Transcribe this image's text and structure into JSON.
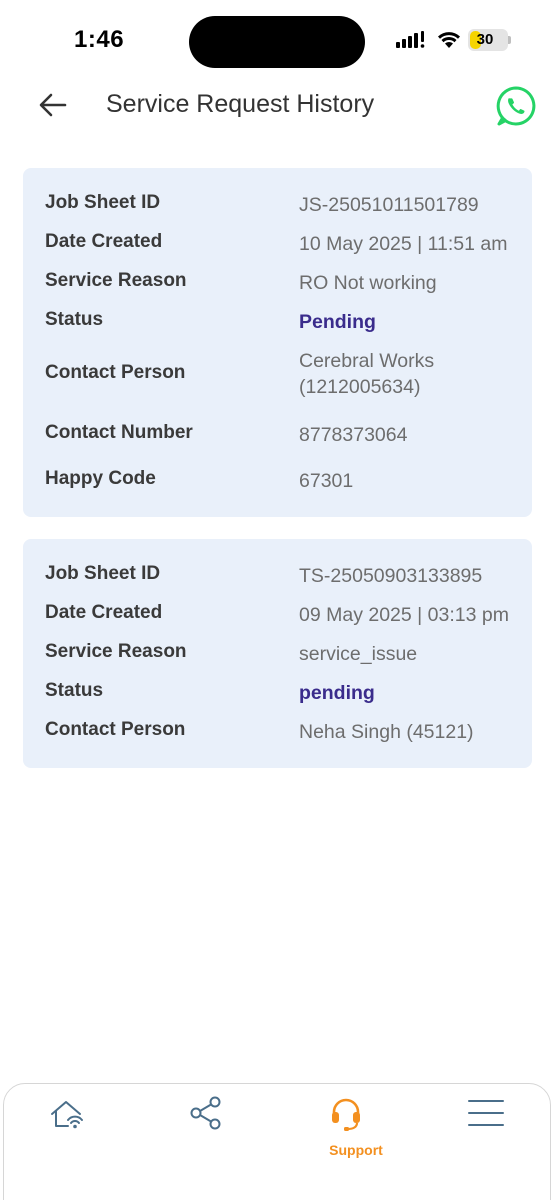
{
  "status_bar": {
    "time": "1:46",
    "battery": "30",
    "battery_level": 0.3
  },
  "header": {
    "title": "Service Request History"
  },
  "colors": {
    "accent": "#f39020",
    "status_text": "#3a2c8c",
    "card_bg": "#e9f0fa",
    "whatsapp": "#25d366",
    "nav_icon": "#4a6e8a"
  },
  "requests": [
    {
      "rows": [
        {
          "label": "Job Sheet ID",
          "value": "JS-25051011501789"
        },
        {
          "label": "Date Created",
          "value": "10 May 2025 | 11:51 am"
        },
        {
          "label": "Service Reason",
          "value": "RO Not working"
        },
        {
          "label": "Status",
          "value": "Pending"
        },
        {
          "label": "Contact Person",
          "value": "Cerebral Works (1212005634)"
        },
        {
          "label": "Contact Number",
          "value": "8778373064"
        },
        {
          "label": "Happy Code",
          "value": "67301"
        }
      ]
    },
    {
      "rows": [
        {
          "label": "Job Sheet ID",
          "value": "TS-25050903133895"
        },
        {
          "label": "Date Created",
          "value": "09 May 2025 | 03:13 pm"
        },
        {
          "label": "Service Reason",
          "value": "service_issue"
        },
        {
          "label": "Status",
          "value": "pending"
        },
        {
          "label": "Contact Person",
          "value": "Neha Singh (45121)"
        }
      ]
    }
  ],
  "bottom_nav": {
    "items": [
      {
        "icon": "home-wifi-icon",
        "label": ""
      },
      {
        "icon": "share-icon",
        "label": ""
      },
      {
        "icon": "headset-icon",
        "label": "Support"
      },
      {
        "icon": "menu-icon",
        "label": ""
      }
    ]
  }
}
